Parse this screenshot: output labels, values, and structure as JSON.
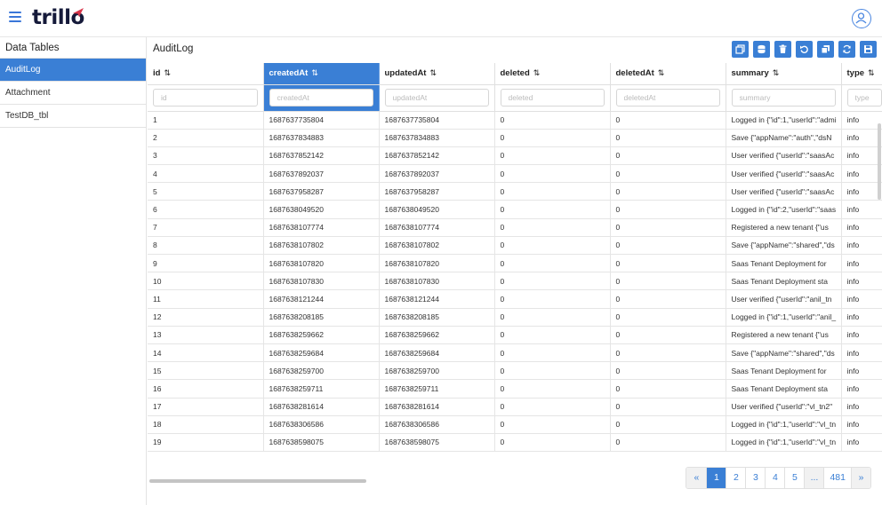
{
  "app": {
    "logo": "trillo"
  },
  "sidebar": {
    "title": "Data Tables",
    "items": [
      {
        "label": "AuditLog"
      },
      {
        "label": "Attachment"
      },
      {
        "label": "TestDB_tbl"
      }
    ]
  },
  "main": {
    "title": "AuditLog"
  },
  "toolbar": {
    "icons": [
      "copy-icon",
      "database-icon",
      "trash-icon",
      "undo-icon",
      "duplicate-icon",
      "refresh-icon",
      "save-icon"
    ]
  },
  "table": {
    "sort_glyph": "⇅",
    "columns": [
      {
        "label": "id",
        "placeholder": "id"
      },
      {
        "label": "createdAt",
        "placeholder": "createdAt"
      },
      {
        "label": "updatedAt",
        "placeholder": "updatedAt"
      },
      {
        "label": "deleted",
        "placeholder": "deleted"
      },
      {
        "label": "deletedAt",
        "placeholder": "deletedAt"
      },
      {
        "label": "summary",
        "placeholder": "summary"
      },
      {
        "label": "type",
        "placeholder": "type"
      }
    ],
    "rows": [
      [
        "1",
        "1687637735804",
        "1687637735804",
        "0",
        "0",
        "Logged in {\"id\":1,\"userId\":\"admi",
        "info"
      ],
      [
        "2",
        "1687637834883",
        "1687637834883",
        "0",
        "0",
        "Save {\"appName\":\"auth\",\"dsN",
        "info"
      ],
      [
        "3",
        "1687637852142",
        "1687637852142",
        "0",
        "0",
        "User verified {\"userId\":\"saasAc",
        "info"
      ],
      [
        "4",
        "1687637892037",
        "1687637892037",
        "0",
        "0",
        "User verified {\"userId\":\"saasAc",
        "info"
      ],
      [
        "5",
        "1687637958287",
        "1687637958287",
        "0",
        "0",
        "User verified {\"userId\":\"saasAc",
        "info"
      ],
      [
        "6",
        "1687638049520",
        "1687638049520",
        "0",
        "0",
        "Logged in {\"id\":2,\"userId\":\"saas",
        "info"
      ],
      [
        "7",
        "1687638107774",
        "1687638107774",
        "0",
        "0",
        "Registered a new tenant {\"us",
        "info"
      ],
      [
        "8",
        "1687638107802",
        "1687638107802",
        "0",
        "0",
        "Save {\"appName\":\"shared\",\"ds",
        "info"
      ],
      [
        "9",
        "1687638107820",
        "1687638107820",
        "0",
        "0",
        "Saas Tenant Deployment for",
        "info"
      ],
      [
        "10",
        "1687638107830",
        "1687638107830",
        "0",
        "0",
        "Saas Tenant Deployment sta",
        "info"
      ],
      [
        "11",
        "1687638121244",
        "1687638121244",
        "0",
        "0",
        "User verified {\"userId\":\"anil_tn",
        "info"
      ],
      [
        "12",
        "1687638208185",
        "1687638208185",
        "0",
        "0",
        "Logged in {\"id\":1,\"userId\":\"anil_",
        "info"
      ],
      [
        "13",
        "1687638259662",
        "1687638259662",
        "0",
        "0",
        "Registered a new tenant {\"us",
        "info"
      ],
      [
        "14",
        "1687638259684",
        "1687638259684",
        "0",
        "0",
        "Save {\"appName\":\"shared\",\"ds",
        "info"
      ],
      [
        "15",
        "1687638259700",
        "1687638259700",
        "0",
        "0",
        "Saas Tenant Deployment for",
        "info"
      ],
      [
        "16",
        "1687638259711",
        "1687638259711",
        "0",
        "0",
        "Saas Tenant Deployment sta",
        "info"
      ],
      [
        "17",
        "1687638281614",
        "1687638281614",
        "0",
        "0",
        "User verified {\"userId\":\"vl_tn2\"",
        "info"
      ],
      [
        "18",
        "1687638306586",
        "1687638306586",
        "0",
        "0",
        "Logged in {\"id\":1,\"userId\":\"vl_tn",
        "info"
      ],
      [
        "19",
        "1687638598075",
        "1687638598075",
        "0",
        "0",
        "Logged in {\"id\":1,\"userId\":\"vl_tn",
        "info"
      ]
    ]
  },
  "pagination": {
    "items": [
      "«",
      "1",
      "2",
      "3",
      "4",
      "5",
      "...",
      "481",
      "»"
    ],
    "current": "1"
  },
  "colors": {
    "accent": "#3a7fd5",
    "logo": "#151a3a"
  }
}
